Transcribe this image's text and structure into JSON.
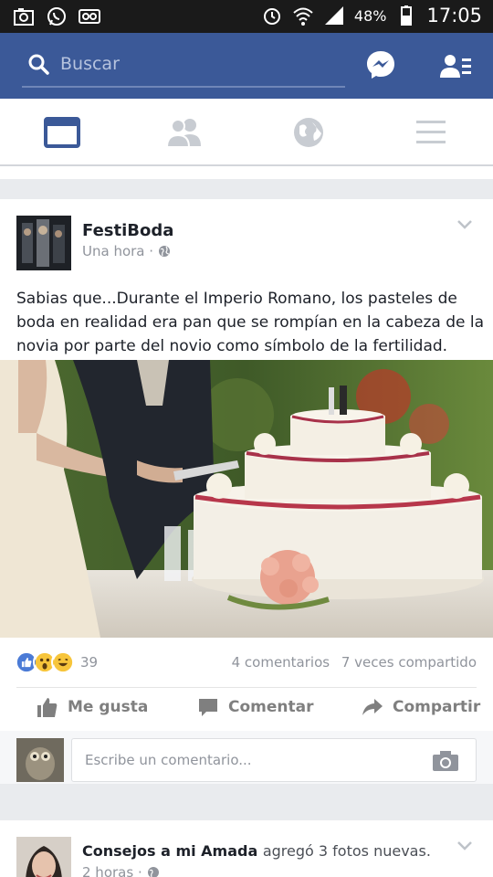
{
  "status_bar": {
    "battery": "48%",
    "time": "17:05",
    "left_icons": [
      "camera-icon",
      "whatsapp-icon",
      "voicemail-icon"
    ],
    "right_icons": [
      "alarm-icon",
      "wifi-icon",
      "signal-icon",
      "battery-icon"
    ]
  },
  "header": {
    "search_placeholder": "Buscar",
    "icons": [
      "search-icon",
      "messenger-icon",
      "friend-requests-icon"
    ]
  },
  "tabs": [
    {
      "name": "news-feed",
      "icon": "news-feed-icon",
      "active": true
    },
    {
      "name": "friends",
      "icon": "friends-icon",
      "active": false
    },
    {
      "name": "notifications",
      "icon": "globe-icon",
      "active": false
    },
    {
      "name": "menu",
      "icon": "menu-icon",
      "active": false
    }
  ],
  "colors": {
    "brand": "#3b5998",
    "active_tab": "#3b5998",
    "inactive_tab": "#c8ccd2",
    "muted_text": "#90949c"
  },
  "post": {
    "author": "FestiBoda",
    "time": "Una hora",
    "separator": "·",
    "text": "Sabias que...Durante el Imperio Romano, los pasteles de boda en realidad era pan que se rompían en la cabeza de la novia por parte del novio como símbolo de la fertilidad.",
    "reaction_count": "39",
    "reactions": [
      "like",
      "wow",
      "haha"
    ],
    "comments": "4 comentarios",
    "shares": "7 veces compartido",
    "actions": {
      "like": "Me gusta",
      "comment": "Comentar",
      "share": "Compartir"
    },
    "comment_placeholder": "Escribe un comentario..."
  },
  "next_post": {
    "author": "Consejos a mi Amada",
    "action_text": "agregó 3 fotos nuevas.",
    "time": "2 horas",
    "separator": "·"
  }
}
